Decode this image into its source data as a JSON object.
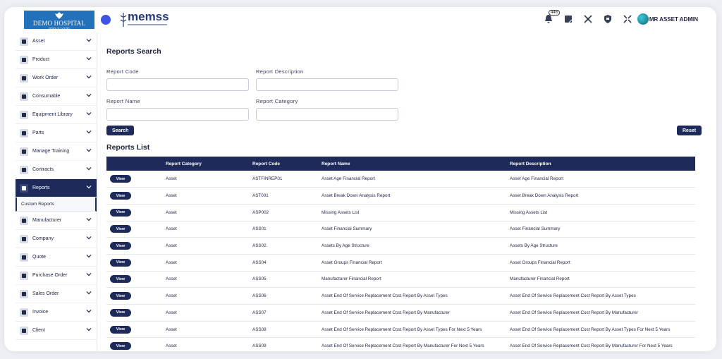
{
  "header": {
    "hospital_name": "DEMO HOSPITAL TRUST",
    "app_logo": "memss",
    "notification_count": "446",
    "user_name": "MR ASSET ADMIN"
  },
  "sidebar": {
    "items": [
      {
        "label": "Asset",
        "icon": "asset-icon"
      },
      {
        "label": "Product",
        "icon": "product-icon"
      },
      {
        "label": "Work Order",
        "icon": "work-order-icon"
      },
      {
        "label": "Consumable",
        "icon": "consumable-icon"
      },
      {
        "label": "Equipment Library",
        "icon": "equipment-library-icon"
      },
      {
        "label": "Parts",
        "icon": "parts-icon"
      },
      {
        "label": "Manage Training",
        "icon": "training-icon"
      },
      {
        "label": "Contracts",
        "icon": "contracts-icon"
      },
      {
        "label": "Reports",
        "icon": "reports-icon"
      },
      {
        "label": "Manufacturer",
        "icon": "manufacturer-icon"
      },
      {
        "label": "Company",
        "icon": "company-icon"
      },
      {
        "label": "Quote",
        "icon": "quote-icon"
      },
      {
        "label": "Purchase Order",
        "icon": "purchase-order-icon"
      },
      {
        "label": "Sales Order",
        "icon": "sales-order-icon"
      },
      {
        "label": "Invoice",
        "icon": "invoice-icon"
      },
      {
        "label": "Client",
        "icon": "client-icon"
      }
    ],
    "sub_item": "Custom Reports"
  },
  "search": {
    "title": "Reports Search",
    "report_code_label": "Report Code",
    "report_description_label": "Report Description",
    "report_name_label": "Report Name",
    "report_category_label": "Report Category",
    "search_label": "Search",
    "reset_label": "Reset"
  },
  "list": {
    "title": "Reports List",
    "columns": [
      "Report Category",
      "Report Code",
      "Report Name",
      "Report Description"
    ],
    "view_label": "View",
    "rows": [
      {
        "category": "Asset",
        "code": "ASTFINREP01",
        "name": "Asset Age Financial Report",
        "description": "Asset Age Financial Report"
      },
      {
        "category": "Asset",
        "code": "AST001",
        "name": "Asset Break Down Analysis Report",
        "description": "Asset Break Down Analysis Report"
      },
      {
        "category": "Asset",
        "code": "ASP002",
        "name": "Missing Assets List",
        "description": "Missing Assets List"
      },
      {
        "category": "Asset",
        "code": "ASS01",
        "name": "Asset Financial Summary",
        "description": "Asset Financial Summary"
      },
      {
        "category": "Asset",
        "code": "ASS02",
        "name": "Assets By Age Structure",
        "description": "Assets By Age Structure"
      },
      {
        "category": "Asset",
        "code": "ASS04",
        "name": "Asset Groups Financial Report",
        "description": "Asset Groups Financial Report"
      },
      {
        "category": "Asset",
        "code": "ASS05",
        "name": "Manufacturer Financial Report",
        "description": "Manufacturer Financial Report"
      },
      {
        "category": "Asset",
        "code": "ASS06",
        "name": "Asset End Of Service Replacement Cost Report By Asset Types",
        "description": "Asset End Of Service Replacement Cost Report By Asset Types"
      },
      {
        "category": "Asset",
        "code": "ASS07",
        "name": "Asset End Of Service Replacement Cost Report By Manufacturer",
        "description": "Asset End Of Service Replacement Cost Report By Manufacturer"
      },
      {
        "category": "Asset",
        "code": "ASS08",
        "name": "Asset End Of Service Replacement Cost Report By Asset Types For Next 5 Years",
        "description": "Asset End Of Service Replacement Cost Report By Asset Types For Next 5 Years"
      },
      {
        "category": "Asset",
        "code": "ASS09",
        "name": "Asset End Of Service Replacement Cost Report By Manufacturer For Next 5 Years",
        "description": "Asset End Of Service Replacement Cost Report By Manufacturer For Next 5 Years"
      }
    ]
  }
}
